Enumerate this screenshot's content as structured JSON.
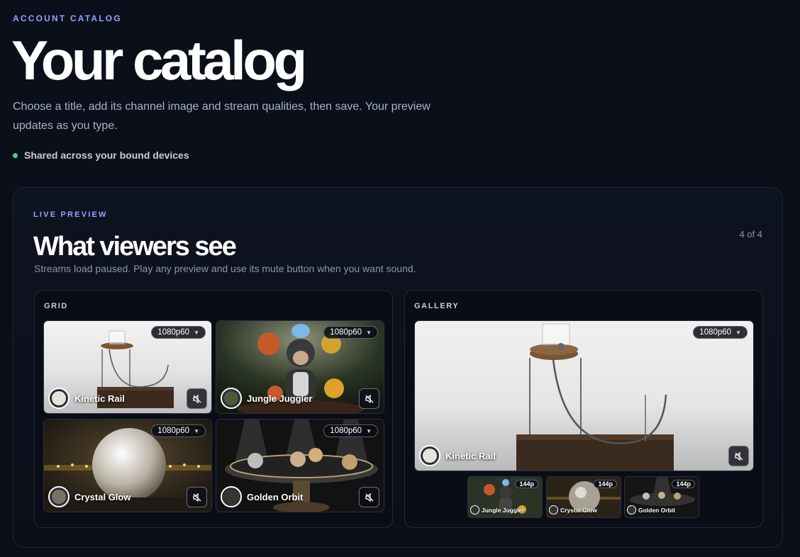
{
  "header": {
    "eyebrow": "ACCOUNT CATALOG",
    "title": "Your catalog",
    "intro": "Choose a title, add its channel image and stream qualities, then save. Your preview updates as you type.",
    "shared_status": "Shared across your bound devices"
  },
  "preview": {
    "eyebrow": "LIVE PREVIEW",
    "title": "What viewers see",
    "subtitle": "Streams load paused. Play any preview and use its mute button when you want sound.",
    "pager": "4 of 4",
    "grid": {
      "label": "GRID",
      "tiles": [
        {
          "name": "Kinetic Rail",
          "quality": "1080p60"
        },
        {
          "name": "Jungle Juggler",
          "quality": "1080p60"
        },
        {
          "name": "Crystal Glow",
          "quality": "1080p60"
        },
        {
          "name": "Golden Orbit",
          "quality": "1080p60"
        }
      ]
    },
    "gallery": {
      "label": "GALLERY",
      "main": {
        "name": "Kinetic Rail",
        "quality": "1080p60"
      },
      "thumbs": [
        {
          "name": "Jungle Juggler",
          "quality": "144p"
        },
        {
          "name": "Crystal Glow",
          "quality": "144p"
        },
        {
          "name": "Golden Orbit",
          "quality": "144p"
        }
      ]
    }
  },
  "icons": {
    "mute": "speaker-muted-icon",
    "caret": "chevron-down-icon",
    "status": "status-dot-icon"
  },
  "colors": {
    "background": "#0b0f1a",
    "accent": "#8ea4ff",
    "status_green": "#4fd07f"
  }
}
